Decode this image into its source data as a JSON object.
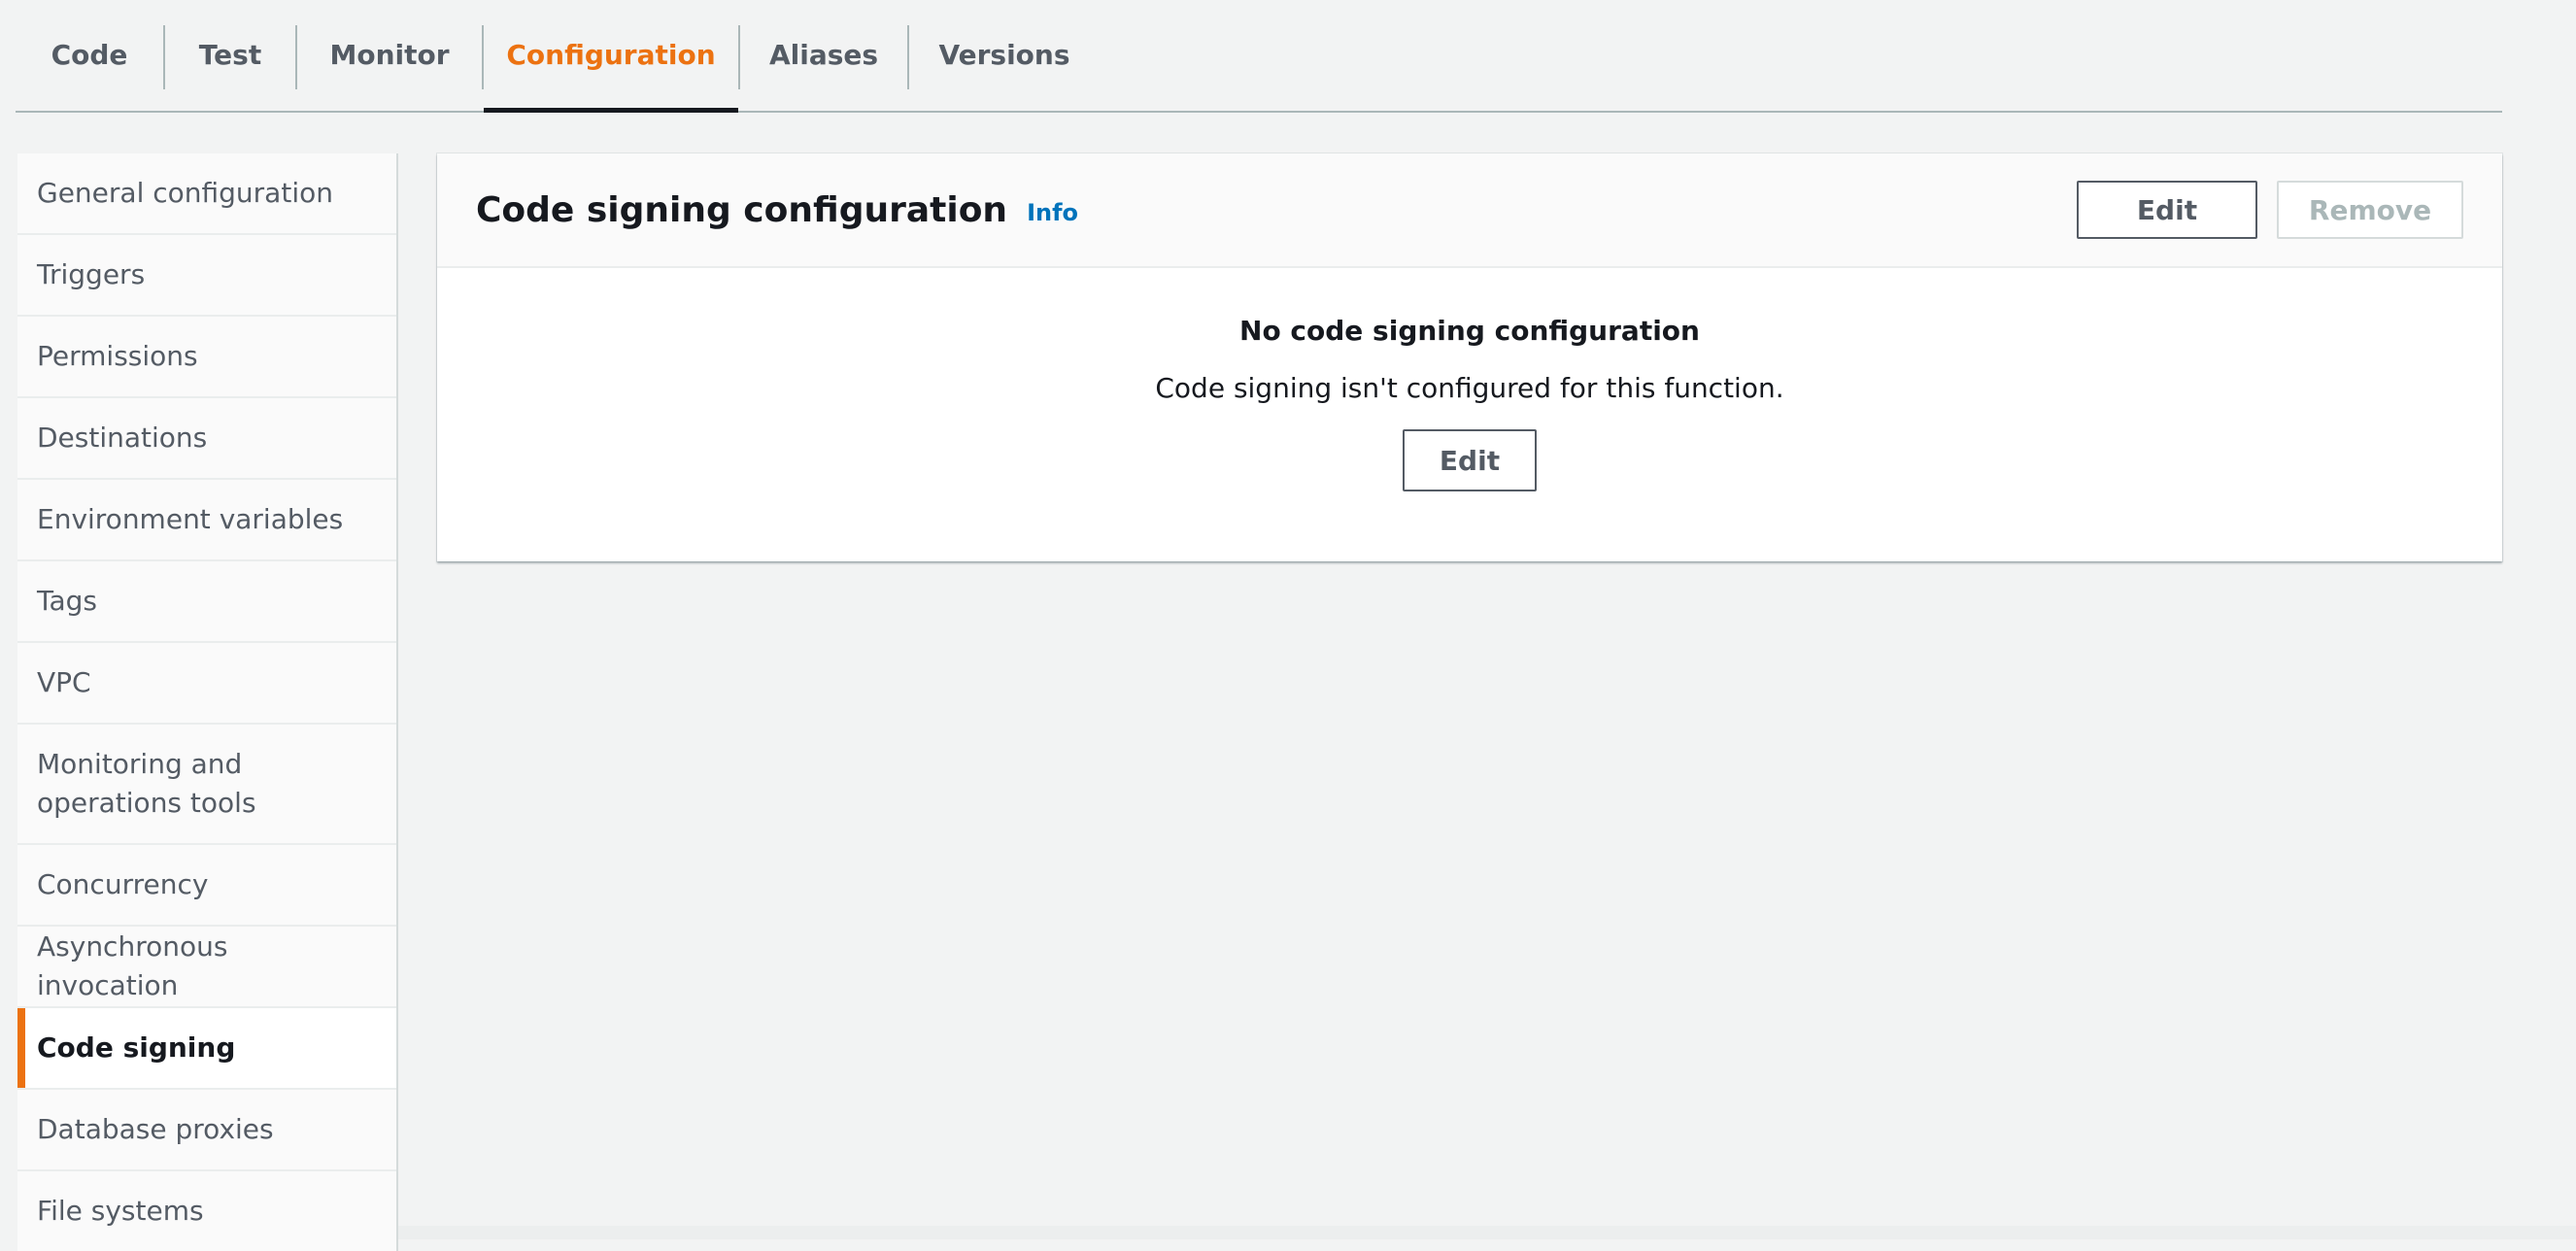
{
  "tabs": [
    {
      "label": "Code",
      "active": false
    },
    {
      "label": "Test",
      "active": false
    },
    {
      "label": "Monitor",
      "active": false
    },
    {
      "label": "Configuration",
      "active": true
    },
    {
      "label": "Aliases",
      "active": false
    },
    {
      "label": "Versions",
      "active": false
    }
  ],
  "sidenav": {
    "items": [
      {
        "label": "General configuration"
      },
      {
        "label": "Triggers"
      },
      {
        "label": "Permissions"
      },
      {
        "label": "Destinations"
      },
      {
        "label": "Environment variables"
      },
      {
        "label": "Tags"
      },
      {
        "label": "VPC"
      },
      {
        "label": "Monitoring and operations tools"
      },
      {
        "label": "Concurrency"
      },
      {
        "label": "Asynchronous invocation"
      },
      {
        "label": "Code signing",
        "active": true
      },
      {
        "label": "Database proxies"
      },
      {
        "label": "File systems"
      }
    ]
  },
  "panel": {
    "title": "Code signing configuration",
    "info_label": "Info",
    "edit_label": "Edit",
    "remove_label": "Remove",
    "empty_title": "No code signing configuration",
    "empty_description": "Code signing isn't configured for this function.",
    "empty_edit_label": "Edit"
  },
  "colors": {
    "accent": "#ec7211",
    "link": "#0073bb",
    "text": "#16191f",
    "muted": "#545b64",
    "background": "#f2f3f3"
  }
}
